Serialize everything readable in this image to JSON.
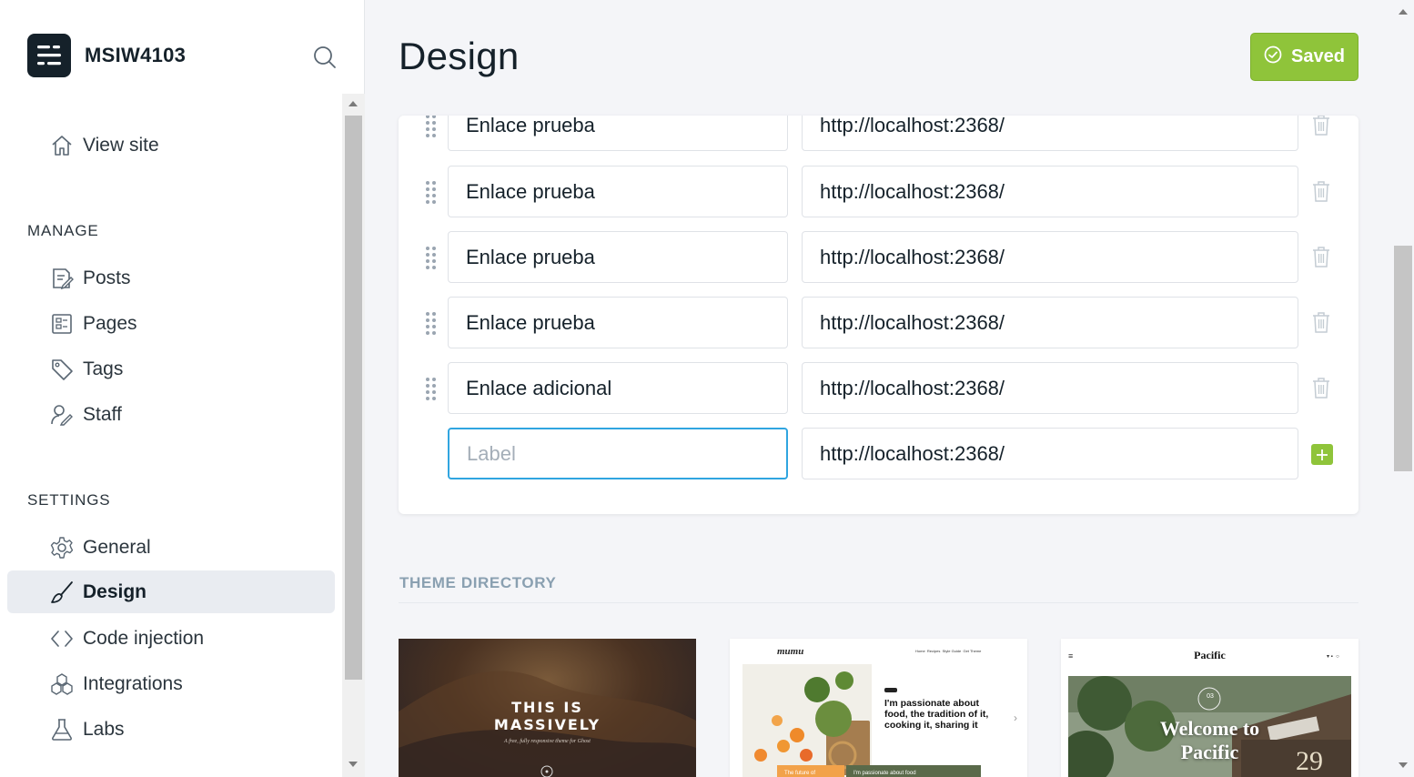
{
  "brand": {
    "name": "MSIW4103"
  },
  "sidebar": {
    "view_site": "View site",
    "manage_heading": "MANAGE",
    "manage_items": [
      {
        "label": "Posts",
        "icon": "posts-icon"
      },
      {
        "label": "Pages",
        "icon": "pages-icon"
      },
      {
        "label": "Tags",
        "icon": "tag-icon"
      },
      {
        "label": "Staff",
        "icon": "staff-icon"
      }
    ],
    "settings_heading": "SETTINGS",
    "settings_items": [
      {
        "label": "General",
        "icon": "gear-icon"
      },
      {
        "label": "Design",
        "icon": "brush-icon",
        "active": true
      },
      {
        "label": "Code injection",
        "icon": "code-icon"
      },
      {
        "label": "Integrations",
        "icon": "integrations-icon"
      },
      {
        "label": "Labs",
        "icon": "flask-icon"
      }
    ]
  },
  "header": {
    "title": "Design",
    "save_label": "Saved"
  },
  "navigation": {
    "rows": [
      {
        "label": "Enlace prueba",
        "url": "http://localhost:2368/"
      },
      {
        "label": "Enlace prueba",
        "url": "http://localhost:2368/"
      },
      {
        "label": "Enlace prueba",
        "url": "http://localhost:2368/"
      },
      {
        "label": "Enlace prueba",
        "url": "http://localhost:2368/"
      },
      {
        "label": "Enlace adicional",
        "url": "http://localhost:2368/"
      }
    ],
    "new_item": {
      "label_placeholder": "Label",
      "url": "http://localhost:2368/"
    }
  },
  "theme_directory": {
    "heading": "THEME DIRECTORY",
    "themes": [
      {
        "title_line1": "THIS IS",
        "title_line2": "MASSIVELY",
        "tagline": "A free, fully responsive theme for Ghost"
      },
      {
        "logo": "mumu",
        "menu": "Home  Recipes  Style Guide  Get Theme",
        "headline": "I'm passionate about food, the tradition of it, cooking it, sharing it",
        "card1": "The future of",
        "card2": "I'm passionate about food"
      },
      {
        "name": "Pacific",
        "date_day": "03",
        "hero_line1": "Welcome to",
        "hero_line2": "Pacific",
        "sign_number": "29"
      }
    ]
  },
  "colors": {
    "accent": "#8fc43a",
    "focus": "#30a5e0",
    "text": "#15212a",
    "muted": "#8aa0b1"
  }
}
